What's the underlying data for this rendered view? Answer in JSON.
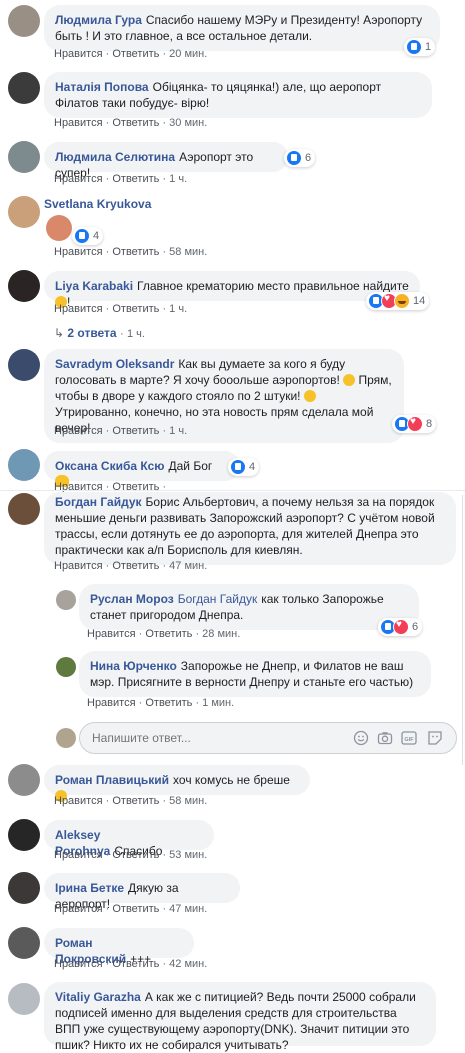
{
  "comments": [
    {
      "name": "Людмила Гура",
      "text": "Спасибо нашему МЭРу и Президенту! Аэропорту быть ! И это главное, а все остальное детали.",
      "like": "Нравится",
      "reply": "Ответить",
      "time": "20 мин.",
      "reactions": "1"
    },
    {
      "name": "Наталія Попова",
      "text": "Обіцянка- то цяцянка!) але, що аеропорт Філатов таки побудує- вірю!",
      "like": "Нравится",
      "reply": "Ответить",
      "time": "30 мин."
    },
    {
      "name": "Людмила Селютина",
      "text": "Аэропорт это супер!",
      "like": "Нравится",
      "reply": "Ответить",
      "time": "1 ч.",
      "reactions": "6"
    },
    {
      "name": "Svetlana Kryukova",
      "text": "",
      "like": "Нравится",
      "reply": "Ответить",
      "time": "58 мин.",
      "reactions": "4"
    },
    {
      "name": "Liya Karabaki",
      "text": "Главное крематорию место правильное найдите",
      "text_end": "!",
      "like": "Нравится",
      "reply": "Ответить",
      "time": "1 ч.",
      "reactions": "14",
      "replies_link": "2 ответа",
      "replies_time": "1 ч."
    },
    {
      "name": "Savradym Oleksandr",
      "text": "Как вы думаете за кого я буду голосовать в марте? Я хочу бооольше аэропортов!",
      "text2": "Прям, чтобы в дворе у каждого стояло по 2 штуки!",
      "text3": "Утрированно, конечно, но эта новость прям сделала мой вечер!",
      "like": "Нравится",
      "reply": "Ответить",
      "time": "1 ч.",
      "reactions": "8"
    },
    {
      "name": "Оксана Скиба Ксю",
      "text": "Дай Бог",
      "like": "Нравится",
      "reply": "Ответить",
      "time": "",
      "reactions": "4"
    },
    {
      "name": "Богдан Гайдук",
      "text": "Борис Альбертович, а почему нельзя за на порядок меньшие деньги развивать Запорожский аэропорт? С учётом новой трассы, если дотянуть ее до аэропорта, для жителей Днепра это практически как а/п Борисполь для киевлян.",
      "like": "Нравится",
      "reply": "Ответить",
      "time": "47 мин."
    }
  ],
  "replies": [
    {
      "name": "Руслан Мороз",
      "mention": "Богдан Гайдук",
      "text": "как только Запорожье станет пригородом Днепра.",
      "like": "Нравится",
      "reply": "Ответить",
      "time": "28 мин.",
      "reactions": "6"
    },
    {
      "name": "Нина Юрченко",
      "text": "Запорожье не Днепр, и Филатов не ваш мэр. Присягните в верности Днепру и станьте его частью)",
      "like": "Нравится",
      "reply": "Ответить",
      "time": "1 мин."
    }
  ],
  "reply_input": {
    "placeholder": "Напишите ответ..."
  },
  "comments2": [
    {
      "name": "Роман Плавицький",
      "text": "хоч комусь не бреше",
      "like": "Нравится",
      "reply": "Ответить",
      "time": "58 мин."
    },
    {
      "name": "Aleksey Porohnya",
      "text": "Спасибо",
      "like": "Нравится",
      "reply": "Ответить",
      "time": "53 мин."
    },
    {
      "name": "Ірина Бетке",
      "text": "Дякую за аеропорт!",
      "like": "Нравится",
      "reply": "Ответить",
      "time": "47 мин."
    },
    {
      "name": "Роман Покровский",
      "text": "+++",
      "like": "Нравится",
      "reply": "Ответить",
      "time": "42 мин."
    },
    {
      "name": "Vitaliy Garazha",
      "text": "А как же с питицией? Ведь почти 25000 собрали подписей именно для выделения средств для строительства ВПП уже существующему аэропорту(DNK). Значит питиции это пшик? Никто их не собирался учитывать?",
      "like": "",
      "reply": "",
      "time": ""
    }
  ],
  "sep": "·",
  "colors": {
    "link": "#385898",
    "bubble": "#f2f3f5",
    "meta": "#606770",
    "like": "#1877f2",
    "love": "#f33e58",
    "haha": "#f7b125"
  }
}
